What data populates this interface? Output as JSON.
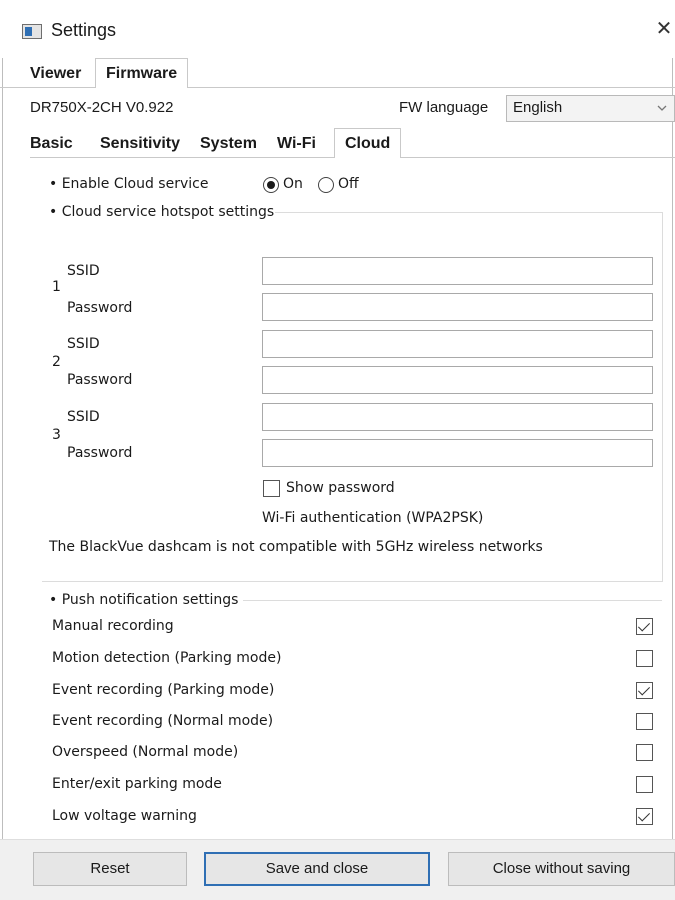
{
  "window": {
    "title": "Settings",
    "close_glyph": "✕"
  },
  "top_tabs": {
    "viewer": "Viewer",
    "firmware": "Firmware"
  },
  "model": "DR750X-2CH V0.922",
  "fw_language": {
    "label": "FW language",
    "value": "English",
    "icon": "chevron-down-icon"
  },
  "sub_tabs": {
    "basic": "Basic",
    "sensitivity": "Sensitivity",
    "system": "System",
    "wifi": "Wi-Fi",
    "cloud": "Cloud"
  },
  "cloud": {
    "enable_label": "• Enable Cloud service",
    "on_label": "On",
    "off_label": "Off",
    "enabled": "On",
    "hotspot_title": "• Cloud service hotspot settings",
    "hotspots": [
      {
        "num": "1",
        "ssid_label": "SSID",
        "password_label": "Password",
        "ssid": "",
        "password": ""
      },
      {
        "num": "2",
        "ssid_label": "SSID",
        "password_label": "Password",
        "ssid": "",
        "password": ""
      },
      {
        "num": "3",
        "ssid_label": "SSID",
        "password_label": "Password",
        "ssid": "",
        "password": ""
      }
    ],
    "show_password_label": "Show password",
    "auth_text": "Wi-Fi authentication (WPA2PSK)",
    "compat_note": "The BlackVue dashcam is not compatible with 5GHz wireless networks"
  },
  "push": {
    "title": "• Push notification settings",
    "items": [
      {
        "label": "Manual recording",
        "checked": true
      },
      {
        "label": "Motion detection (Parking mode)",
        "checked": false
      },
      {
        "label": "Event recording (Parking mode)",
        "checked": true
      },
      {
        "label": "Event recording (Normal mode)",
        "checked": false
      },
      {
        "label": "Overspeed (Normal mode)",
        "checked": false
      },
      {
        "label": "Enter/exit parking mode",
        "checked": false
      },
      {
        "label": "Low voltage warning",
        "checked": true
      }
    ]
  },
  "buttons": {
    "reset": "Reset",
    "save": "Save and close",
    "close_without_saving": "Close without saving"
  },
  "colors": {
    "focus_blue": "#2f6fb4",
    "bottom_bar": "#f0f0f0"
  }
}
